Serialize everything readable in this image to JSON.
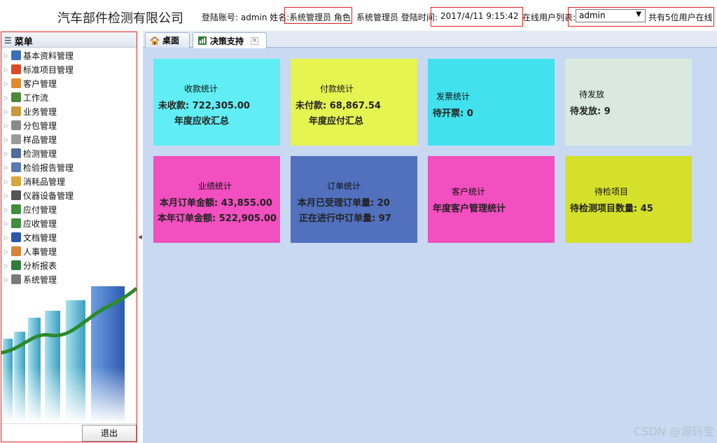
{
  "header": {
    "company": "汽车部件检测有限公司",
    "account_label": "登陆账号: admin 姓名:",
    "name_role": "系统管理员 角色",
    "role_value": "系统管理员 登陆时间:",
    "login_time": "2017/4/11 9:15:42",
    "online_list_label": "在线用户列表:",
    "online_user_selected": "admin",
    "online_count": "共有5位用户在线"
  },
  "sidebar": {
    "title": "菜单",
    "items": [
      {
        "label": "基本资料管理",
        "icon": "book-icon",
        "color": "#3b6fb6"
      },
      {
        "label": "标准项目管理",
        "icon": "calendar-icon",
        "color": "#d94b2b"
      },
      {
        "label": "客户管理",
        "icon": "user-icon",
        "color": "#e08a2b"
      },
      {
        "label": "工作流",
        "icon": "workflow-icon",
        "color": "#4a8a3a"
      },
      {
        "label": "业务管理",
        "icon": "documents-icon",
        "color": "#c79a3a"
      },
      {
        "label": "分包管理",
        "icon": "package-icon",
        "color": "#8a8a8a"
      },
      {
        "label": "样品管理",
        "icon": "copy-icon",
        "color": "#9a9a9a"
      },
      {
        "label": "检测管理",
        "icon": "monitor-icon",
        "color": "#4f6c9a"
      },
      {
        "label": "检验报告管理",
        "icon": "report-icon",
        "color": "#5a7bb0"
      },
      {
        "label": "消耗品管理",
        "icon": "box-icon",
        "color": "#d8a83a"
      },
      {
        "label": "仪器设备管理",
        "icon": "camera-icon",
        "color": "#555555"
      },
      {
        "label": "应付管理",
        "icon": "money-out-icon",
        "color": "#3e8e3e"
      },
      {
        "label": "应收管理",
        "icon": "money-in-icon",
        "color": "#3e8e3e"
      },
      {
        "label": "文档管理",
        "icon": "word-doc-icon",
        "color": "#2b57a8"
      },
      {
        "label": "人事管理",
        "icon": "people-icon",
        "color": "#d9823b"
      },
      {
        "label": "分析报表",
        "icon": "excel-icon",
        "color": "#2f7d3a"
      },
      {
        "label": "系统管理",
        "icon": "gear-icon",
        "color": "#7a7a7a"
      }
    ],
    "logout_label": "退出"
  },
  "tabs": [
    {
      "label": "桌面",
      "icon": "home-icon"
    },
    {
      "label": "决策支持",
      "icon": "chart-icon"
    }
  ],
  "cards": [
    {
      "title": "收款统计",
      "lines": [
        "未收款: 722,305.00",
        "年度应收汇总"
      ],
      "color": "#60eef4"
    },
    {
      "title": "付款统计",
      "lines": [
        "未付款: 68,867.54",
        "年度应付汇总"
      ],
      "color": "#e6f452"
    },
    {
      "title": "发票统计",
      "lines": [
        "待开票: 0"
      ],
      "color": "#41e1ee"
    },
    {
      "title": "待发放",
      "lines": [
        "待发放: 9"
      ],
      "color": "#d9e9e0"
    },
    {
      "title": "业绩统计",
      "lines": [
        "本月订单金额: 43,855.00",
        "本年订单金额: 522,905.00"
      ],
      "color": "#f24fc0"
    },
    {
      "title": "订单统计",
      "lines": [
        "本月已受理订单量: 20",
        "正在进行中订单量: 97"
      ],
      "color": "#5170bd"
    },
    {
      "title": "客户统计",
      "lines": [
        "年度客户管理统计"
      ],
      "color": "#f24fc0"
    },
    {
      "title": "待检项目",
      "lines": [
        "待检测项目数量: 45"
      ],
      "color": "#d5e02a"
    }
  ],
  "watermark": "CSDN @源码宝"
}
